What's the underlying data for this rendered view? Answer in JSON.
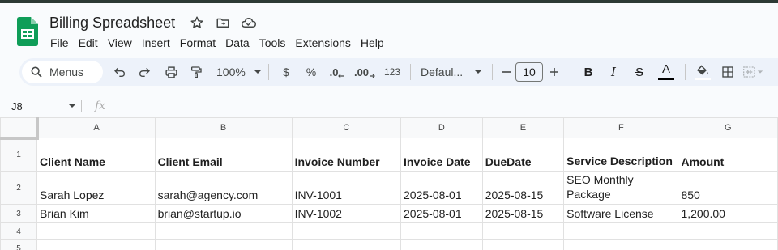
{
  "app": {
    "title": "Billing Spreadsheet",
    "menu": [
      "File",
      "Edit",
      "View",
      "Insert",
      "Format",
      "Data",
      "Tools",
      "Extensions",
      "Help"
    ],
    "accent": "#0f9d58"
  },
  "toolbar": {
    "search_label": "Menus",
    "zoom": "100%",
    "currency": "$",
    "percent": "%",
    "dec_decrease": ".0",
    "dec_increase": ".00",
    "number_format": "123",
    "font": "Defaul...",
    "font_size": "10",
    "bold": "B",
    "italic": "I",
    "strike": "S",
    "text_color": "A"
  },
  "formula_bar": {
    "cell_ref": "J8",
    "fx": "fx"
  },
  "sheet": {
    "columns": [
      "A",
      "B",
      "C",
      "D",
      "E",
      "F",
      "G"
    ],
    "row_numbers": [
      "1",
      "2",
      "3",
      "4",
      "5"
    ],
    "rows": [
      [
        "Client Name",
        "Client Email",
        "Invoice Number",
        "Invoice Date",
        "DueDate",
        "Service Description",
        "Amount"
      ],
      [
        "Sarah Lopez",
        "sarah@agency.com",
        "INV-1001",
        "2025-08-01",
        "2025-08-15",
        "SEO Monthly Package",
        "850"
      ],
      [
        "Brian Kim",
        "brian@startup.io",
        "INV-1002",
        "2025-08-01",
        "2025-08-15",
        "Software License",
        "1,200.00"
      ],
      [
        "",
        "",
        "",
        "",
        "",
        "",
        ""
      ],
      [
        "",
        "",
        "",
        "",
        "",
        "",
        ""
      ]
    ]
  }
}
